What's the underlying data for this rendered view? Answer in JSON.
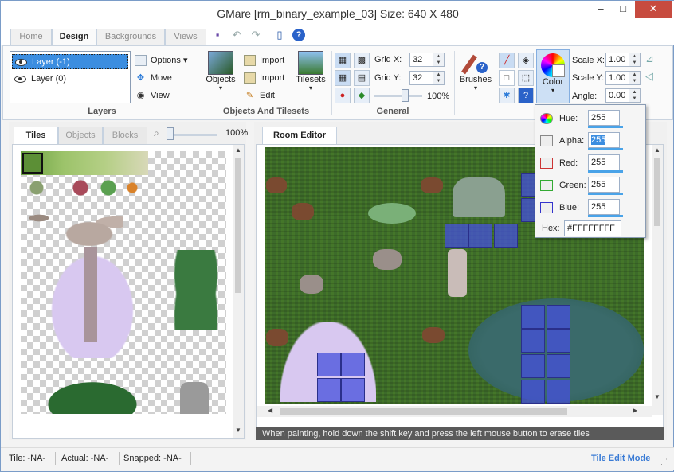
{
  "window": {
    "title": "GMare [rm_binary_example_03] Size: 640 X 480",
    "minimize_label": "–",
    "maximize_label": "□",
    "close_label": "✕"
  },
  "tabs": [
    "Home",
    "Design",
    "Backgrounds",
    "Views"
  ],
  "layers": {
    "items": [
      "Layer (-1)",
      "Layer (0)"
    ],
    "buttons": {
      "options": "Options",
      "move": "Move",
      "view": "View"
    },
    "group_label": "Layers"
  },
  "objects_tilesets": {
    "objects_label": "Objects",
    "import1": "Import",
    "import2": "Import",
    "edit": "Edit",
    "tilesets_label": "Tilesets",
    "group_label": "Objects And Tilesets"
  },
  "general": {
    "grid_x_label": "Grid X:",
    "grid_x": "32",
    "grid_y_label": "Grid Y:",
    "grid_y": "32",
    "zoom": "100%",
    "group_label": "General"
  },
  "brushes_label": "Brushes",
  "color_label": "Color",
  "scale": {
    "scale_x_label": "Scale X:",
    "scale_x": "1.00",
    "scale_y_label": "Scale Y:",
    "scale_y": "1.00",
    "angle_label": "Angle:",
    "angle": "0.00"
  },
  "color_popup": {
    "hue_label": "Hue:",
    "hue": "255",
    "alpha_label": "Alpha:",
    "alpha": "255",
    "red_label": "Red:",
    "red": "255",
    "green_label": "Green:",
    "green": "255",
    "blue_label": "Blue:",
    "blue": "255",
    "hex_label": "Hex:",
    "hex": "#FFFFFFFF"
  },
  "tiles_panel": {
    "tabs": [
      "Tiles",
      "Objects",
      "Blocks"
    ],
    "zoom": "100%"
  },
  "room_editor": {
    "tab": "Room Editor",
    "hint": "When painting, hold down the shift key and press the left mouse button to erase tiles"
  },
  "status": {
    "tile": "Tile: -NA-",
    "actual": "Actual: -NA-",
    "snapped": "Snapped: -NA-",
    "mode": "Tile Edit Mode"
  },
  "colors": {
    "accent": "#3b8de0",
    "mode_text": "#3a7bd5"
  }
}
